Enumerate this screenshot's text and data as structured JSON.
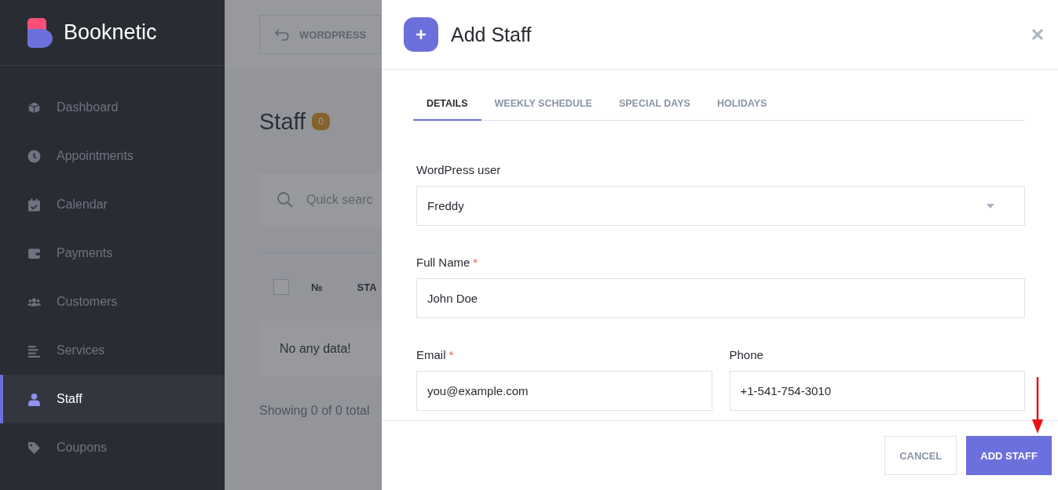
{
  "sidebar": {
    "brand": "Booknetic",
    "items": [
      {
        "label": "Dashboard",
        "selected": false
      },
      {
        "label": "Appointments",
        "selected": false
      },
      {
        "label": "Calendar",
        "selected": false
      },
      {
        "label": "Payments",
        "selected": false
      },
      {
        "label": "Customers",
        "selected": false
      },
      {
        "label": "Services",
        "selected": false
      },
      {
        "label": "Staff",
        "selected": true
      },
      {
        "label": "Coupons",
        "selected": false
      }
    ]
  },
  "topbar": {
    "back_button": "WORDPRESS"
  },
  "page": {
    "title": "Staff",
    "count": "0",
    "search_placeholder": "Quick searc",
    "table": {
      "select_all": {
        "checked": false
      },
      "columns": [
        "№",
        "STA"
      ],
      "empty_text": "No any data!"
    },
    "footer_text": "Showing 0 of 0 total"
  },
  "modal": {
    "title": "Add Staff",
    "tabs": [
      {
        "label": "DETAILS",
        "selected": true
      },
      {
        "label": "WEEKLY SCHEDULE",
        "selected": false
      },
      {
        "label": "SPECIAL DAYS",
        "selected": false
      },
      {
        "label": "HOLIDAYS",
        "selected": false
      }
    ],
    "rows": [
      [
        {
          "label": "WordPress user",
          "kind": "select",
          "value": "Freddy"
        }
      ],
      [
        {
          "label": "Full Name",
          "required_mark": "*",
          "kind": "text",
          "value": "John Doe"
        }
      ],
      [
        {
          "label": "Email",
          "required_mark": "*",
          "kind": "text",
          "value": "you@example.com"
        },
        {
          "label": "Phone",
          "kind": "text",
          "value": "+1-541-754-3010"
        }
      ]
    ],
    "cancel_button": "CANCEL",
    "submit_button": "ADD STAFF"
  }
}
